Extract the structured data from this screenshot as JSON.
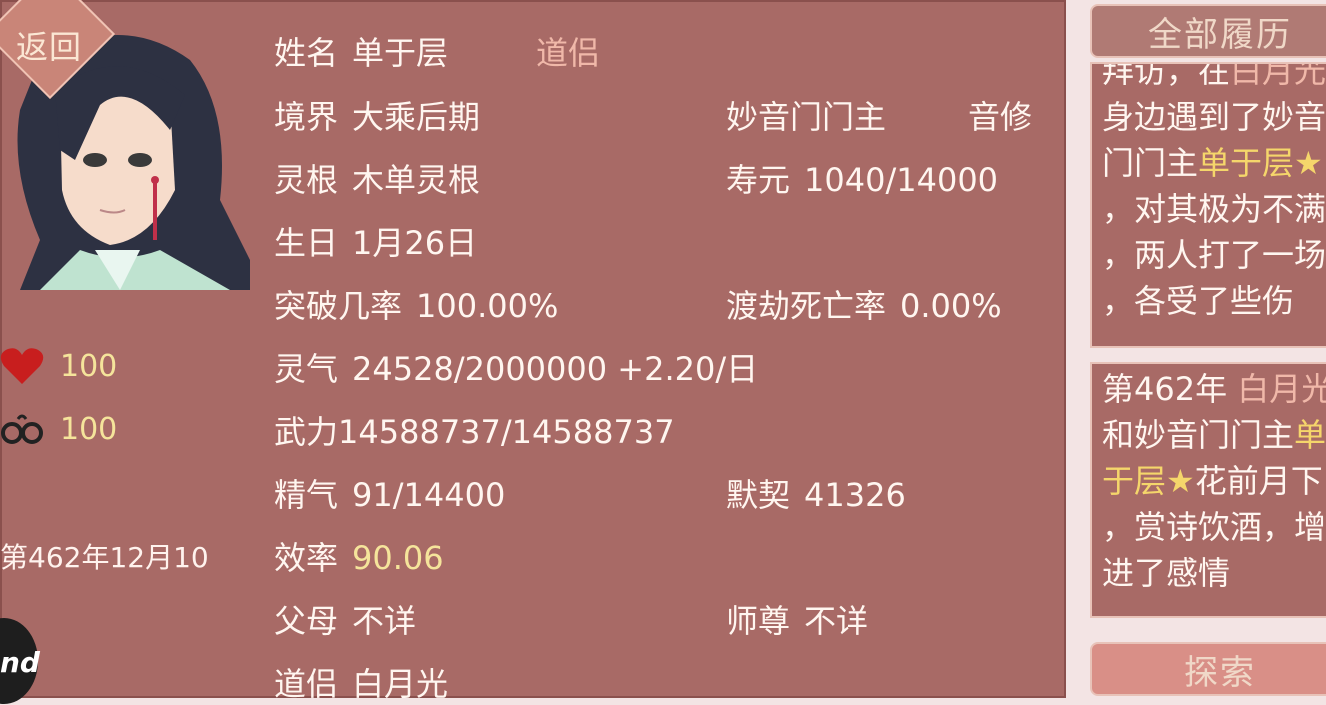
{
  "back_button": "返回",
  "stats": {
    "health_value": "100",
    "shackle_value": "100"
  },
  "current_date": "第462年12月10",
  "corner_badge": "nd",
  "info": {
    "name_label": "姓名",
    "name_value": "单于层",
    "relation_tag": "道侣",
    "realm_label": "境界",
    "realm_value": "大乘后期",
    "sect_title": "妙音门门主",
    "cultivation_type": "音修",
    "root_label": "灵根",
    "root_value": "木单灵根",
    "lifespan_label": "寿元",
    "lifespan_value": "1040/14000",
    "birthday_label": "生日",
    "birthday_value": "1月26日",
    "breakthrough_label": "突破几率",
    "breakthrough_value": "100.00%",
    "tribulation_label": "渡劫死亡率",
    "tribulation_value": "0.00%",
    "qi_label": "灵气",
    "qi_value": "24528/2000000 +2.20/日",
    "force_label": "武力",
    "force_value": "14588737/14588737",
    "essence_label": "精气",
    "essence_value": "91/14400",
    "bond_label": "默契",
    "bond_value": "41326",
    "efficiency_label": "效率",
    "efficiency_value": "90.06",
    "parents_label": "父母",
    "parents_value": "不详",
    "master_label": "师尊",
    "master_value": "不详",
    "partner_label": "道侣",
    "partner_value": "白月光"
  },
  "sidebar": {
    "all_history_button": "全部履历",
    "explore_button": "探索",
    "history_1": {
      "line1_a": "拜访，在",
      "line1_b": "白月光",
      "line2": "身边遇到了妙音",
      "line3_a": "门门主",
      "line3_b": "单于层★",
      "line4": "，对其极为不满",
      "line5": "，两人打了一场",
      "line6": "，各受了些伤"
    },
    "history_2": {
      "line1_a": "第462年 ",
      "line1_b": "白月光",
      "line2_a": "和妙音门门主",
      "line2_b": "单",
      "line3_a": "于层★",
      "line3_b": "花前月下",
      "line4": "，赏诗饮酒，增",
      "line5": "进了感情"
    }
  }
}
